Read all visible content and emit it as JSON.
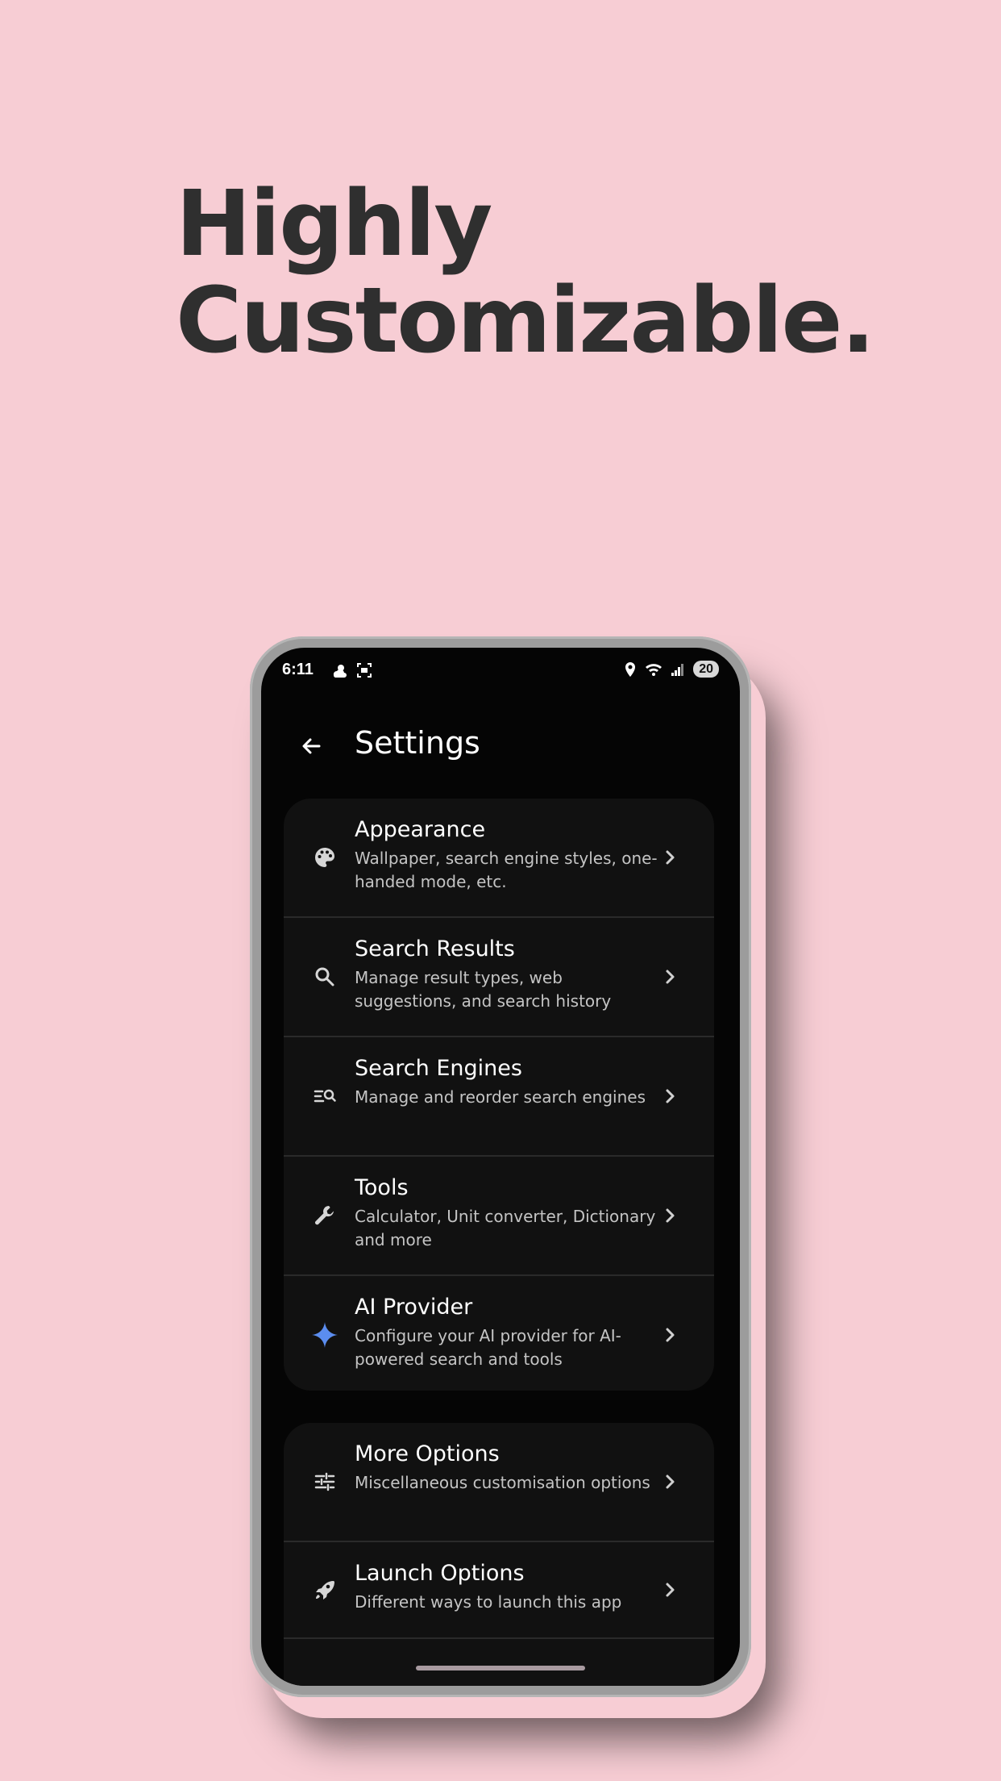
{
  "headline": {
    "line1": "Highly",
    "line2": "Customizable."
  },
  "status_bar": {
    "time": "6:11",
    "battery": "20",
    "icons": [
      "weather-icon",
      "screenshot-icon",
      "location-icon",
      "wifi-icon",
      "signal-icon"
    ]
  },
  "app_bar": {
    "title": "Settings",
    "back_icon": "arrow-left-icon"
  },
  "settings_main": [
    {
      "icon": "palette-icon",
      "title": "Appearance",
      "subtitle": "Wallpaper, search engine styles, one-handed mode, etc."
    },
    {
      "icon": "search-icon",
      "title": "Search Results",
      "subtitle": "Manage result types, web suggestions, and search history"
    },
    {
      "icon": "manage-search-icon",
      "title": "Search Engines",
      "subtitle": "Manage and reorder search engines"
    },
    {
      "icon": "wrench-icon",
      "title": "Tools",
      "subtitle": "Calculator, Unit converter, Dictionary and more"
    },
    {
      "icon": "sparkle-icon",
      "title": "AI Provider",
      "subtitle": "Configure your AI provider for AI-powered search and tools"
    }
  ],
  "settings_more": [
    {
      "icon": "tune-icon",
      "title": "More Options",
      "subtitle": "Miscellaneous customisation options"
    },
    {
      "icon": "rocket-icon",
      "title": "Launch Options",
      "subtitle": "Different ways to launch this app"
    }
  ],
  "colors": {
    "background": "#f7cdd4",
    "headline": "#2f2f2f",
    "screen": "#050505",
    "card": "#111111",
    "accent_sparkle": "#5b8def"
  }
}
